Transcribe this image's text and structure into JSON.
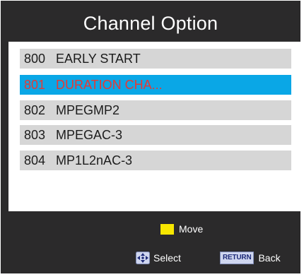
{
  "menu": {
    "title": "Channel Option",
    "items": [
      {
        "number": "800",
        "label": "EARLY START",
        "selected": false
      },
      {
        "number": "801",
        "label": "DURATION CHA...",
        "selected": true
      },
      {
        "number": "802",
        "label": "MPEGMP2",
        "selected": false
      },
      {
        "number": "803",
        "label": "MPEGAC-3",
        "selected": false
      },
      {
        "number": "804",
        "label": "MP1L2nAC-3",
        "selected": false
      }
    ]
  },
  "footer": {
    "move_label": "Move",
    "select_label": "Select",
    "return_key_label": "RETURN",
    "back_label": "Back"
  },
  "colors": {
    "frame": "#2b2a2b",
    "row": "#d6d6d6",
    "selected_row": "#0aa7e6",
    "selected_text": "#e53935",
    "move_key": "#f7e600"
  },
  "icons": {
    "move": "yellow-key-icon",
    "select": "dpad-icon",
    "back": "return-key-icon"
  }
}
